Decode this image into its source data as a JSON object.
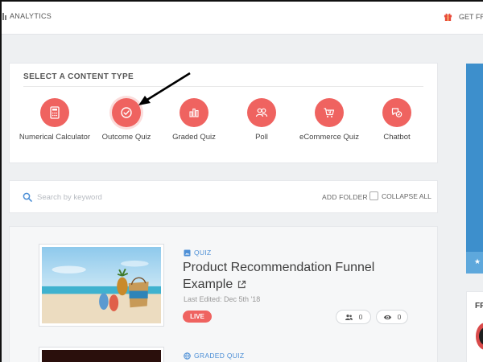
{
  "topbar": {
    "analytics_label": "ANALYTICS",
    "get_free_label": "GET FR"
  },
  "content_type": {
    "title": "SELECT A CONTENT TYPE",
    "items": [
      {
        "label": "Numerical Calculator",
        "icon": "calculator-icon"
      },
      {
        "label": "Outcome Quiz",
        "icon": "check-circle-icon",
        "active": true
      },
      {
        "label": "Graded Quiz",
        "icon": "bar-chart-icon"
      },
      {
        "label": "Poll",
        "icon": "users-icon"
      },
      {
        "label": "eCommerce Quiz",
        "icon": "shopping-cart-icon"
      },
      {
        "label": "Chatbot",
        "icon": "chat-bubbles-icon"
      }
    ]
  },
  "search": {
    "placeholder": "Search by keyword",
    "add_folder_label": "ADD FOLDER",
    "collapse_all_label": "COLLAPSE ALL"
  },
  "list": {
    "items": [
      {
        "type": "QUIZ",
        "title": "Product Recommendation Funnel Example",
        "edited": "Last Edited: Dec 5th '18",
        "status": "LIVE",
        "participants": "0",
        "views": "0"
      },
      {
        "type": "GRADED QUIZ"
      }
    ]
  },
  "right_sidebar": {
    "star": "★",
    "card_heading": "FR"
  },
  "colors": {
    "accent": "#ef6360",
    "link_blue": "#4d8fd6",
    "promo_blue": "#3d8fcc"
  }
}
